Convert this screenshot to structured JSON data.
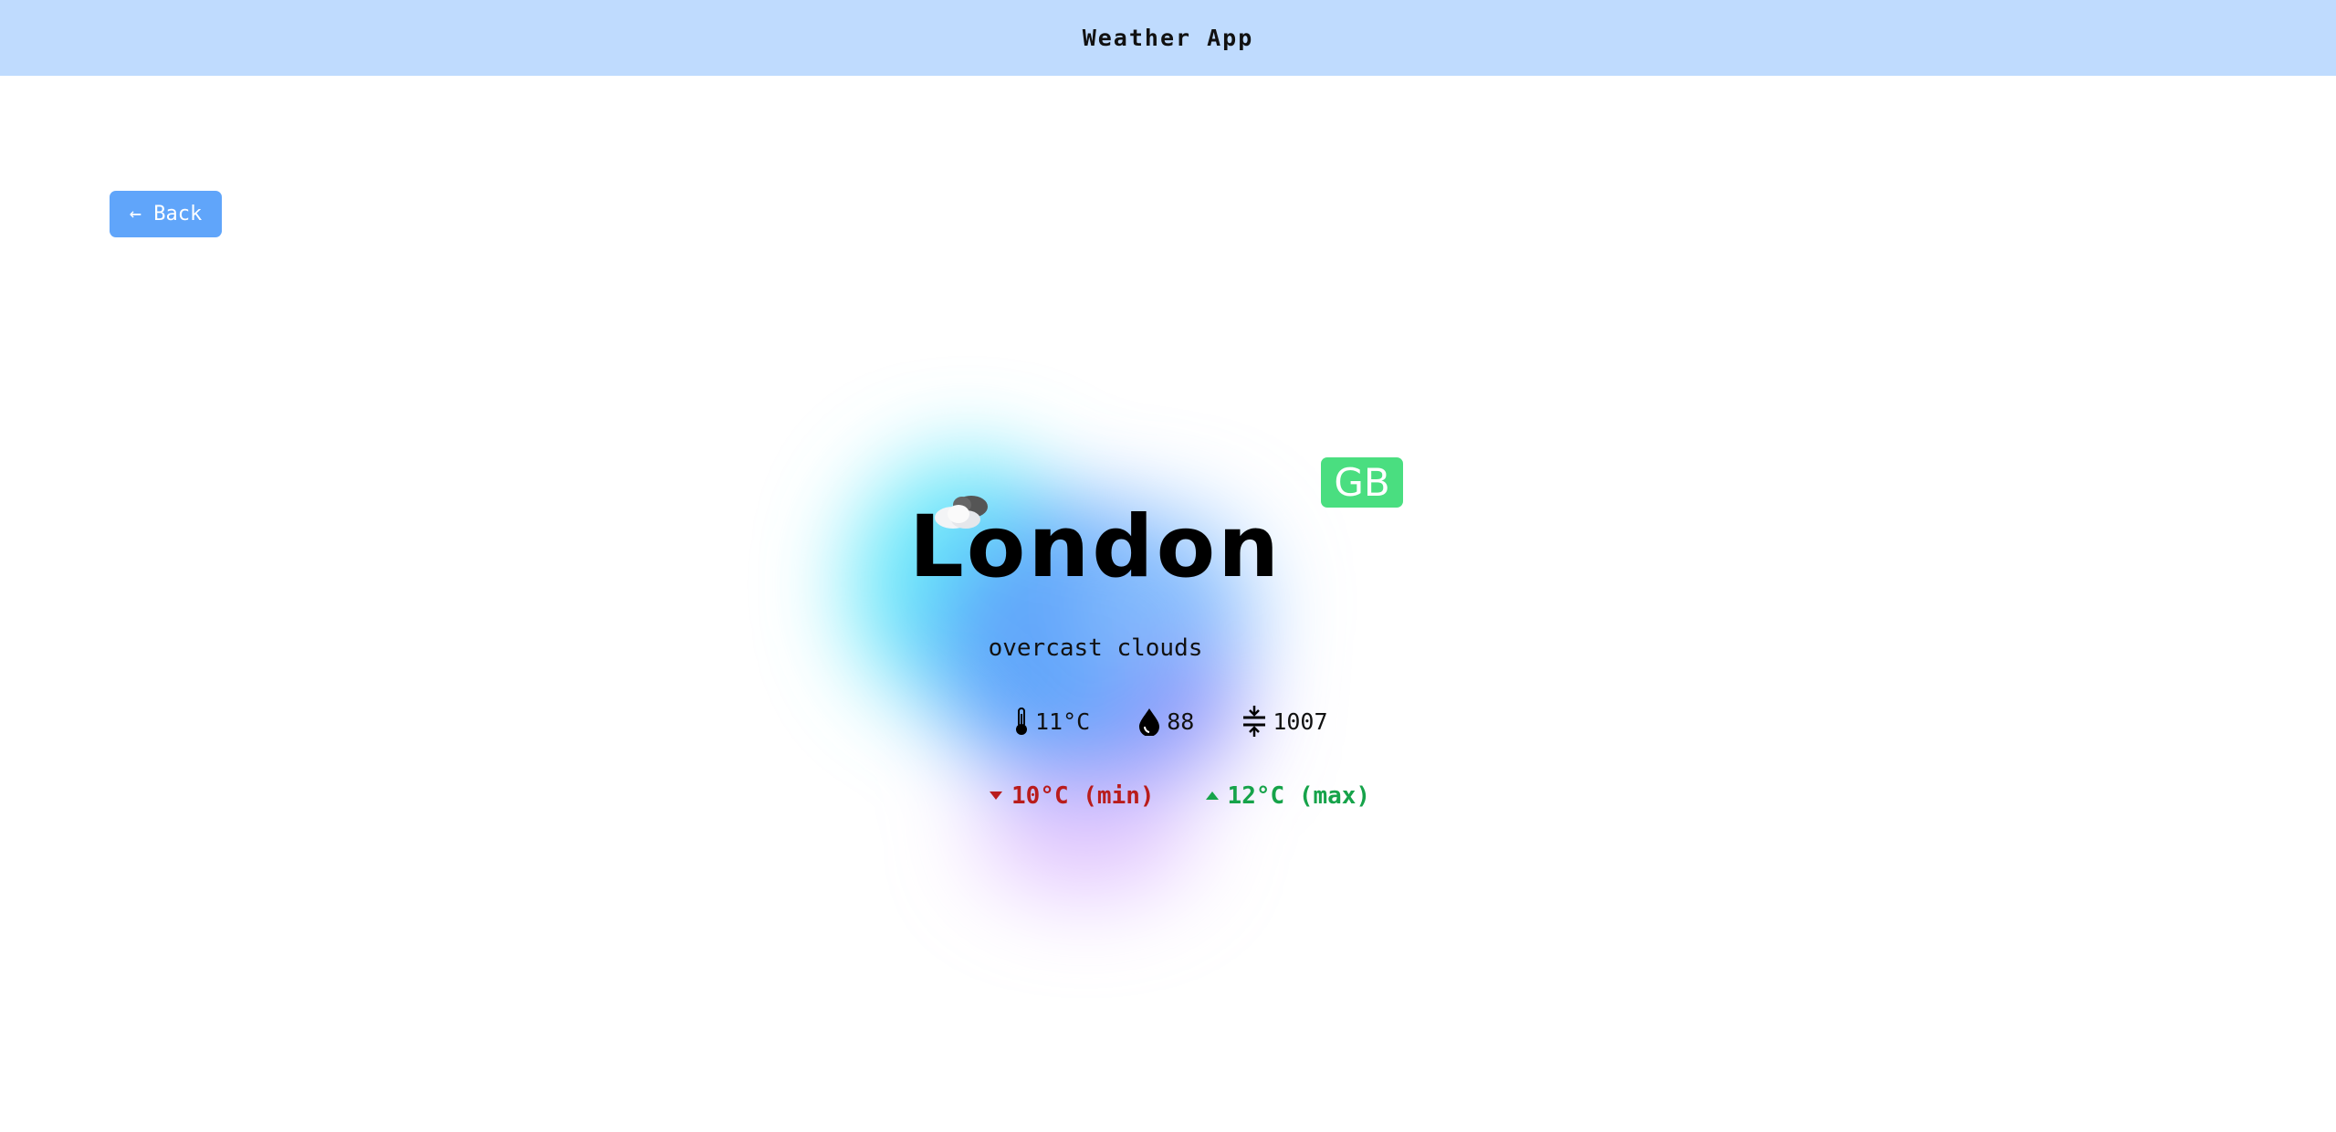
{
  "header": {
    "title": "Weather App"
  },
  "nav": {
    "back_label": "← Back"
  },
  "weather": {
    "city": "London",
    "country_code": "GB",
    "description": "overcast clouds",
    "icon": "overcast-clouds-icon",
    "temperature": "11°C",
    "humidity": "88",
    "pressure": "1007",
    "temp_min": "10°C (min)",
    "temp_max": "12°C (max)"
  },
  "colors": {
    "header_bg": "#bfdbfe",
    "back_button_bg": "#60a5fa",
    "country_badge_bg": "#4ade80",
    "min_color": "#b91c1c",
    "max_color": "#16a34a"
  }
}
